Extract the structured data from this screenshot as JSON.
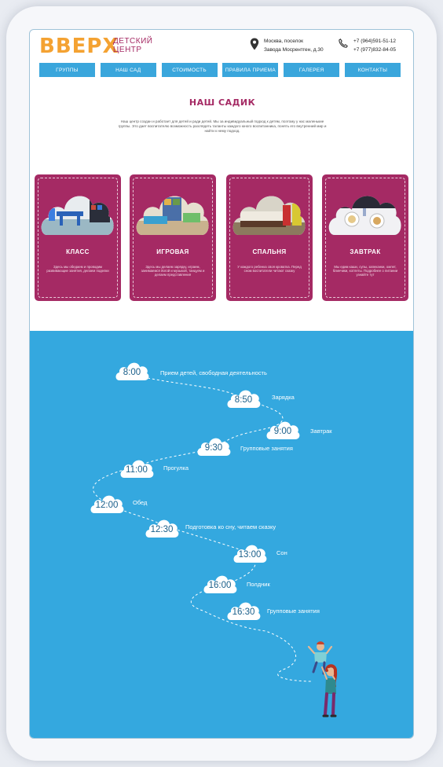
{
  "header": {
    "logo": "ВВЕРХ",
    "logo_sub_line1": "ДЕТСКИЙ",
    "logo_sub_line2": "ЦЕНТР",
    "address_line1": "Москва, поселок",
    "address_line2": "Завода Мосрентген, д.30",
    "phone1": "+7 (964)591-51-12",
    "phone2": "+7 (977)832-84-05",
    "address_icon": "location-pin-icon",
    "phone_icon": "phone-icon"
  },
  "nav": [
    {
      "label": "ГРУППЫ"
    },
    {
      "label": "НАШ САД"
    },
    {
      "label": "СТОИМОСТЬ"
    },
    {
      "label": "ПРАВИЛА ПРИЕМА"
    },
    {
      "label": "ГАЛЕРЕЯ"
    },
    {
      "label": "КОНТАКТЫ"
    }
  ],
  "section": {
    "title": "НАШ САДИК",
    "description": "Наш центр создан и работает для детей и ради детей. Мы за индивидуальный подход к детям, поэтому у нас маленькие группы. Это дает воспитателю возможность разглядеть таланты каждого юного воспитанника, понять его внутренний мир и найти к нему подход."
  },
  "cards": [
    {
      "name": "КЛАСС",
      "text": "Здесь мы обедаем и проводим развивающие занятия, делаем поделки"
    },
    {
      "name": "ИГРОВАЯ",
      "text": "Здесь мы делаем зарядку, играем, занимаемся йогой и музыкой, танцуем и делаем представления"
    },
    {
      "name": "СПАЛЬНЯ",
      "text": "У каждого ребенка своя кроватка. Перед сном воспитатели читают сказку"
    },
    {
      "name": "ЗАВТРАК",
      "text": "Мы едим каши, супы, запеканки, омлет, блинчики, котлеты. Подробнее о питании узнайте тут"
    }
  ],
  "schedule": [
    {
      "time": "8:00",
      "label": "Прием детей, свободная деятельность"
    },
    {
      "time": "8:50",
      "label": "Зарядка"
    },
    {
      "time": "9:00",
      "label": "Завтрак"
    },
    {
      "time": "9:30",
      "label": "Групповые занятия"
    },
    {
      "time": "11:00",
      "label": "Прогулка"
    },
    {
      "time": "12:00",
      "label": "Обед"
    },
    {
      "time": "12:30",
      "label": "Подготовка ко сну, читаем сказку"
    },
    {
      "time": "13:00",
      "label": "Сон"
    },
    {
      "time": "16:00",
      "label": "Полдник"
    },
    {
      "time": "16:30",
      "label": "Групповые занятия"
    }
  ],
  "colors": {
    "brand_orange": "#f4a232",
    "brand_magenta": "#a52a64",
    "nav_blue": "#3aa6dc",
    "schedule_blue": "#34a8df"
  }
}
